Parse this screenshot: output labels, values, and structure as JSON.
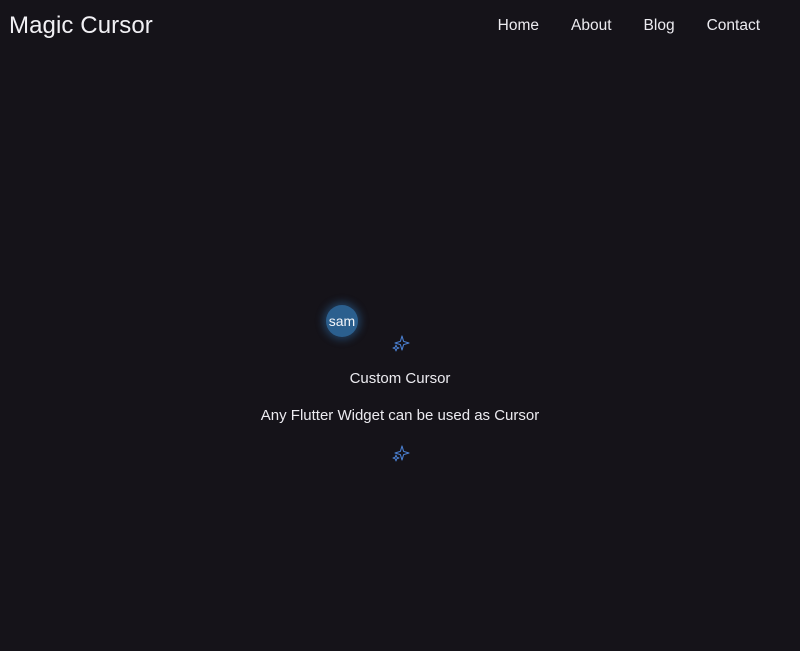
{
  "header": {
    "title": "Magic Cursor",
    "nav": [
      {
        "label": "Home"
      },
      {
        "label": "About"
      },
      {
        "label": "Blog"
      },
      {
        "label": "Contact"
      }
    ]
  },
  "main": {
    "cursor_label": "sam",
    "headline": "Custom Cursor",
    "subline": "Any Flutter Widget can be used as Cursor",
    "icons": [
      "sparkle-icon",
      "sparkle-icon"
    ]
  },
  "colors": {
    "background": "#151319",
    "cursor_bubble": "#2b5f8e",
    "sparkle": "#4a7fd0",
    "text": "#ecebf0"
  }
}
